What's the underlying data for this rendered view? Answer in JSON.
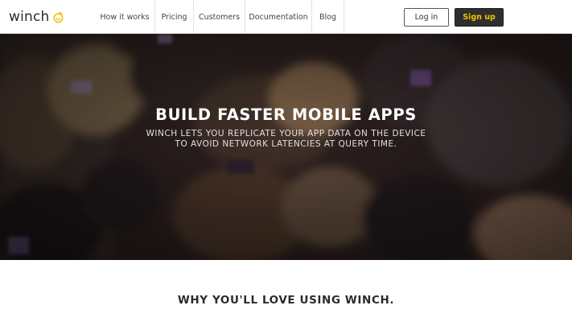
{
  "header": {
    "logo_text": "winch",
    "nav": [
      {
        "label": "How it works"
      },
      {
        "label": "Pricing"
      },
      {
        "label": "Customers"
      },
      {
        "label": "Documentation"
      },
      {
        "label": "Blog"
      }
    ],
    "login_label": "Log in",
    "signup_label": "Sign up"
  },
  "hero": {
    "title": "BUILD FASTER MOBILE APPS",
    "subtitle_line1": "WINCH LETS YOU REPLICATE YOUR APP DATA ON THE DEVICE",
    "subtitle_line2": "TO AVOID NETWORK LATENCIES AT QUERY TIME."
  },
  "features": {
    "title": "WHY YOU'LL LOVE USING WINCH."
  },
  "colors": {
    "brand_yellow": "#f2c200",
    "signup_bg": "#2e2e2e",
    "hero_overlay": "#2a1f1c"
  },
  "icons": {
    "logo_mark": "sun-swirl-icon"
  }
}
